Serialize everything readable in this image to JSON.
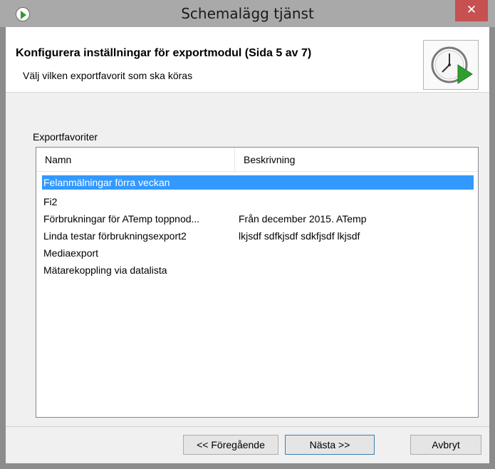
{
  "window": {
    "title": "Schemalägg tjänst",
    "close_glyph": "✕"
  },
  "header": {
    "heading": "Konfigurera inställningar för exportmodul (Sida 5 av 7)",
    "subheading": "Välj vilken exportfavorit som ska köras",
    "icon": "clock-play-icon"
  },
  "group": {
    "label": "Exportfavoriter"
  },
  "list": {
    "columns": [
      "Namn",
      "Beskrivning"
    ],
    "rows": [
      {
        "name": "Felanmälningar förra veckan",
        "description": "",
        "selected": true
      },
      {
        "name": "Fi2",
        "description": "",
        "selected": false
      },
      {
        "name": "Förbrukningar för ATemp  toppnod...",
        "description": "Från december 2015. ATemp",
        "selected": false
      },
      {
        "name": "Linda testar förbrukningsexport2",
        "description": "lkjsdf sdfkjsdf sdkfjsdf lkjsdf",
        "selected": false
      },
      {
        "name": "Mediaexport",
        "description": "",
        "selected": false
      },
      {
        "name": "Mätarekoppling via datalista",
        "description": "",
        "selected": false
      }
    ]
  },
  "buttons": {
    "prev": "<< Föregående",
    "next": "Nästa >>",
    "cancel": "Avbryt"
  },
  "colors": {
    "selection": "#3399ff",
    "close": "#c75050",
    "play": "#2f9e2f"
  }
}
